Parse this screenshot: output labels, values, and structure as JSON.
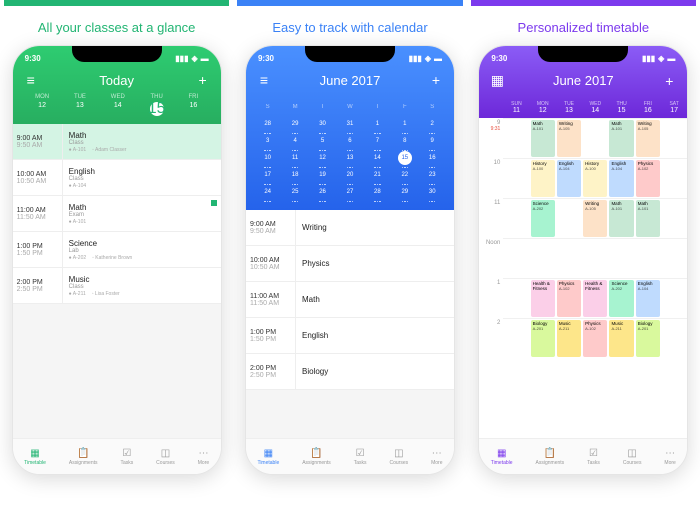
{
  "captions": {
    "p1": "All your classes at a glance",
    "p2": "Easy to track with calendar",
    "p3": "Personalized timetable"
  },
  "status": {
    "time": "9:30"
  },
  "p1": {
    "title": "Today",
    "days": [
      "MON",
      "TUE",
      "WED",
      "THU",
      "FRI"
    ],
    "rows": [
      {
        "t1": "9:00 AM",
        "t2": "9:50 AM",
        "title": "Math",
        "sub": "Class",
        "room": "A-101",
        "teacher": "Adam Classer"
      },
      {
        "t1": "10:00 AM",
        "t2": "10:50 AM",
        "title": "English",
        "sub": "Class",
        "room": "A-104",
        "teacher": ""
      },
      {
        "t1": "11:00 AM",
        "t2": "11:50 AM",
        "title": "Math",
        "sub": "Exam",
        "room": "A-101",
        "teacher": ""
      },
      {
        "t1": "1:00 PM",
        "t2": "1:50 PM",
        "title": "Science",
        "sub": "Lab",
        "room": "A-202",
        "teacher": "Katherine Brown"
      },
      {
        "t1": "2:00 PM",
        "t2": "2:50 PM",
        "title": "Music",
        "sub": "Class",
        "room": "A-211",
        "teacher": "Lisa Foster"
      }
    ]
  },
  "p2": {
    "title": "June 2017",
    "rows": [
      {
        "t1": "9:00 AM",
        "t2": "9:50 AM",
        "title": "Writing"
      },
      {
        "t1": "10:00 AM",
        "t2": "10:50 AM",
        "title": "Physics"
      },
      {
        "t1": "11:00 AM",
        "t2": "11:50 AM",
        "title": "Math"
      },
      {
        "t1": "1:00 PM",
        "t2": "1:50 PM",
        "title": "English"
      },
      {
        "t1": "2:00 PM",
        "t2": "2:50 PM",
        "title": "Biology"
      }
    ]
  },
  "p3": {
    "title": "June 2017",
    "daylabels": [
      "SUN",
      "MON",
      "TUE",
      "WED",
      "THU",
      "FRI",
      "SAT"
    ],
    "daynums": [
      "11",
      "12",
      "13",
      "14",
      "15",
      "16",
      "17"
    ],
    "hours": [
      "9",
      "10",
      "11",
      "Noon",
      "1",
      "2"
    ],
    "now": "9:31",
    "grid": [
      [
        null,
        {
          "t": "Math",
          "r": "A-101",
          "c": "#c7e8d4"
        },
        {
          "t": "Writing",
          "r": "A-105",
          "c": "#fde2c8"
        },
        null,
        {
          "t": "Math",
          "r": "A-101",
          "c": "#c7e8d4"
        },
        {
          "t": "Writing",
          "r": "A-105",
          "c": "#fde2c8"
        },
        null
      ],
      [
        null,
        {
          "t": "History",
          "r": "A-100",
          "c": "#fef3c7"
        },
        {
          "t": "English",
          "r": "A-104",
          "c": "#bfdbfe"
        },
        {
          "t": "History",
          "r": "A-100",
          "c": "#fef3c7"
        },
        {
          "t": "English",
          "r": "A-104",
          "c": "#bfdbfe"
        },
        {
          "t": "Physics",
          "r": "A-102",
          "c": "#fecaca"
        },
        null
      ],
      [
        null,
        {
          "t": "Science",
          "r": "A-202",
          "c": "#a7f3d0"
        },
        null,
        {
          "t": "Writing",
          "r": "A-105",
          "c": "#fde2c8"
        },
        {
          "t": "Math",
          "r": "A-101",
          "c": "#c7e8d4"
        },
        {
          "t": "Math",
          "r": "A-101",
          "c": "#c7e8d4"
        },
        null
      ],
      [
        null,
        null,
        null,
        null,
        null,
        null,
        null
      ],
      [
        null,
        {
          "t": "Health & Fitness",
          "r": "",
          "c": "#fbcfe8"
        },
        {
          "t": "Physics",
          "r": "A-102",
          "c": "#fecaca"
        },
        {
          "t": "Health & Fitness",
          "r": "",
          "c": "#fbcfe8"
        },
        {
          "t": "Science",
          "r": "A-202",
          "c": "#a7f3d0"
        },
        {
          "t": "English",
          "r": "A-104",
          "c": "#bfdbfe"
        },
        null
      ],
      [
        null,
        {
          "t": "Biology",
          "r": "A-201",
          "c": "#d9f99d"
        },
        {
          "t": "Music",
          "r": "A-211",
          "c": "#fde68a"
        },
        {
          "t": "Physics",
          "r": "A-102",
          "c": "#fecaca"
        },
        {
          "t": "Music",
          "r": "A-211",
          "c": "#fde68a"
        },
        {
          "t": "Biology",
          "r": "A-201",
          "c": "#d9f99d"
        },
        null
      ]
    ]
  },
  "tabs": [
    "Timetable",
    "Assignments",
    "Tasks",
    "Courses",
    "More"
  ],
  "tabicons": [
    "▦",
    "📋",
    "☑",
    "◫",
    "⋯"
  ]
}
